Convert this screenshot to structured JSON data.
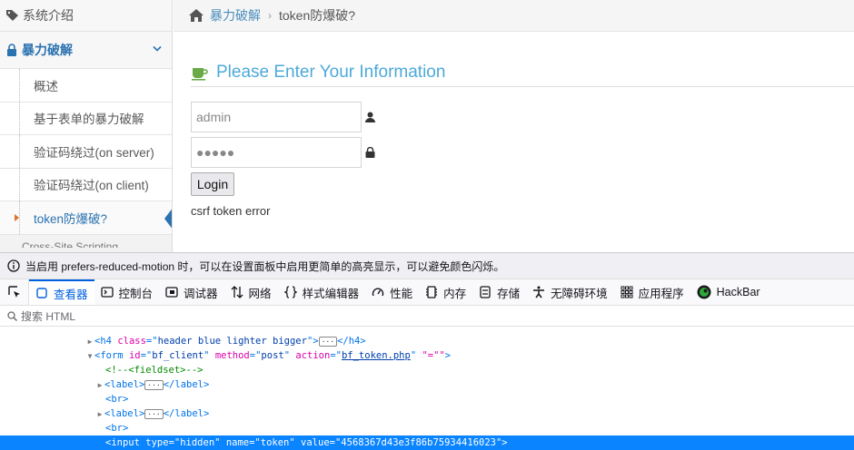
{
  "sidebar": {
    "top_label": "系统介绍",
    "section_label": "暴力破解",
    "items": [
      {
        "label": "概述"
      },
      {
        "label": "基于表单的暴力破解"
      },
      {
        "label": "验证码绕过(on server)"
      },
      {
        "label": "验证码绕过(on client)"
      },
      {
        "label": "token防爆破?"
      }
    ],
    "cut_label": "Cross-Site Scripting"
  },
  "breadcrumb": {
    "link": "暴力破解",
    "separator": "›",
    "current": "token防爆破?"
  },
  "form": {
    "title": "Please Enter Your Information",
    "username_value": "admin",
    "password_value": "●●●●●",
    "login_label": "Login",
    "error_text": "csrf token error"
  },
  "devtools": {
    "notice": "当启用 prefers-reduced-motion 时，可以在设置面板中启用更简单的高亮显示，可以避免颜色闪烁。",
    "tabs": [
      {
        "label": "查看器"
      },
      {
        "label": "控制台"
      },
      {
        "label": "调试器"
      },
      {
        "label": "网络"
      },
      {
        "label": "样式编辑器"
      },
      {
        "label": "性能"
      },
      {
        "label": "内存"
      },
      {
        "label": "存储"
      },
      {
        "label": "无障碍环境"
      },
      {
        "label": "应用程序"
      },
      {
        "label": "HackBar"
      }
    ],
    "search_placeholder": "搜索 HTML",
    "tree": {
      "l1_tag": "h4",
      "l1_attr": "class",
      "l1_val": "header blue lighter bigger",
      "l2_tag": "form",
      "l2_id": "bf_client",
      "l2_method": "post",
      "l2_action": "bf_token.php",
      "l2_extra": "\"=\"\"",
      "l3_comment": "<!--<fieldset>-->",
      "l4_tag": "label",
      "l5_tag": "br",
      "l6_tag": "label",
      "l7_tag": "br",
      "l8_type": "hidden",
      "l8_name": "token",
      "l8_value": "4568367d43e3f86b75934416023"
    }
  },
  "colors": {
    "accent_blue": "#2a72b0",
    "title_blue": "#4caad9",
    "devtools_select": "#0a84ff",
    "marker_orange": "#e0722a"
  }
}
